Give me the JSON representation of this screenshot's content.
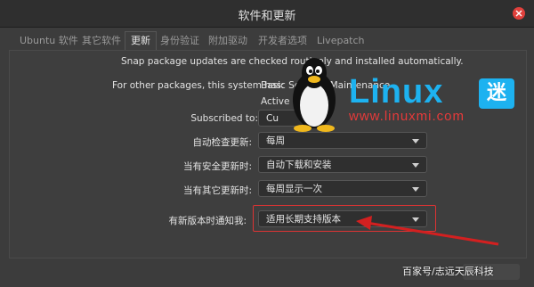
{
  "window": {
    "title": "软件和更新"
  },
  "tabs": [
    "Ubuntu 软件",
    "其它软件",
    "更新",
    "身份验证",
    "附加驱动",
    "开发者选项",
    "Livepatch"
  ],
  "active_tab_index": 2,
  "snap_notice": "Snap package updates are checked routinely and installed automatically.",
  "other_packages": {
    "label": "For other packages, this system has:",
    "value_line1": "Basic Security Maintenance",
    "value_line2": "Active"
  },
  "subscribed": {
    "label": "Subscribed to:",
    "value": "Cu"
  },
  "settings": [
    {
      "label": "自动检查更新:",
      "value": "每周"
    },
    {
      "label": "当有安全更新时:",
      "value": "自动下载和安装"
    },
    {
      "label": "当有其它更新时:",
      "value": "每周显示一次"
    },
    {
      "label": "有新版本时通知我:",
      "value": "适用长期支持版本"
    }
  ],
  "logo": {
    "text": "Linux",
    "mi": "迷",
    "url": "www.linuxmi.com"
  },
  "watermark": "百家号/志远天辰科技",
  "colors": {
    "accent_blue": "#1db2f0",
    "accent_red": "#e63a3a"
  }
}
